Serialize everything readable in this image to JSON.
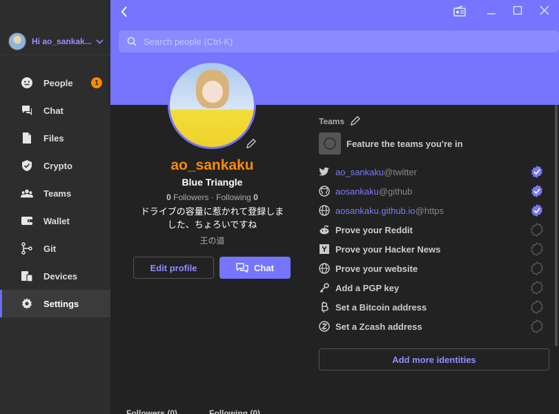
{
  "account": {
    "name": "Hi ao_sankak..."
  },
  "nav": {
    "items": [
      {
        "label": "People",
        "badge": "1"
      },
      {
        "label": "Chat"
      },
      {
        "label": "Files"
      },
      {
        "label": "Crypto"
      },
      {
        "label": "Teams"
      },
      {
        "label": "Wallet"
      },
      {
        "label": "Git"
      },
      {
        "label": "Devices"
      },
      {
        "label": "Settings"
      }
    ]
  },
  "search": {
    "placeholder": "Search people (Ctrl-K)"
  },
  "profile": {
    "username": "ao_sankaku",
    "full_name": "Blue Triangle",
    "followers_count": "0",
    "followers_label": "Followers",
    "separator": " · ",
    "following_count": "0",
    "following_label": "Following",
    "bio_line1": "ドライブの容量に惹かれて登録しま",
    "bio_line2": "した、ちょろいですね",
    "location": "王の道",
    "edit_label": "Edit profile",
    "chat_label": "Chat"
  },
  "tabs": {
    "followers": "Followers (0)",
    "following": "Following (0)"
  },
  "teams": {
    "heading": "Teams",
    "feature_text": "Feature the teams you're in"
  },
  "identities": {
    "verified": [
      {
        "handle": "ao_sankaku",
        "service": "@twitter",
        "icon": "twitter-icon"
      },
      {
        "handle": "aosankaku",
        "service": "@github",
        "icon": "github-icon"
      },
      {
        "handle": "aosankaku.github.io",
        "service": "@https",
        "icon": "globe-icon"
      }
    ],
    "prove": [
      {
        "label": "Prove your Reddit",
        "icon": "reddit-icon"
      },
      {
        "label": "Prove your Hacker News",
        "icon": "hackernews-icon"
      },
      {
        "label": "Prove your website",
        "icon": "globe-icon"
      },
      {
        "label": "Add a PGP key",
        "icon": "key-icon"
      },
      {
        "label": "Set a Bitcoin address",
        "icon": "bitcoin-icon"
      },
      {
        "label": "Set a Zcash address",
        "icon": "zcash-icon"
      }
    ],
    "add_more_label": "Add more identities"
  },
  "colors": {
    "accent": "#7575ff",
    "username": "#ff8a00",
    "badge": "#ff8a00",
    "verified": "#7575ff"
  }
}
